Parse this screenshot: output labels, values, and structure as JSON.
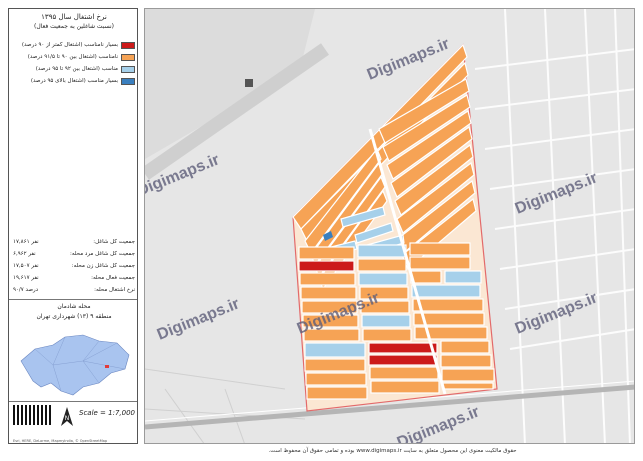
{
  "legend": {
    "title_line1": "نرخ اشتغال سال ۱۳۹۵",
    "title_line2": "(نسبت شاغلین به جمعیت فعال)",
    "items": [
      {
        "label": "بسیار نامناسب (اشتغال کمتر از ۹۰ درصد)",
        "color": "#cc1a1a"
      },
      {
        "label": "نامناسب (اشتغال بین ۹۰ تا ۹۱/۵ درصد)",
        "color": "#f6a355"
      },
      {
        "label": "مناسب (اشتغال بین ۹۲ تا ۹۵ درصد)",
        "color": "#a6d0ea"
      },
      {
        "label": "بسیار مناسب (اشتغال بالای ۹۵ درصد)",
        "color": "#3a7fbf"
      }
    ],
    "stats": [
      {
        "label": "جمعیت کل شاغل:",
        "value": "۱۷,۸۶۱ نفر"
      },
      {
        "label": "جمعیت کل شاغل مرد محله:",
        "value": "۶,۹۶۲ نفر"
      },
      {
        "label": "جمعیت کل شاغل زن محله:",
        "value": "۱۷,۵۰۷ نفر"
      },
      {
        "label": "جمعیت فعال محله:",
        "value": "۱۹,۶۱۷ نفر"
      },
      {
        "label": "نرخ اشتغال محله:",
        "value": "۹۰/۷ درصد"
      }
    ],
    "district_line1": "محله شادمان",
    "district_line2": "منطقه ۹ (۱۳) شهرداری تهران",
    "scale": "Scale = 1:7,000",
    "provider": "Esri, HERE, DeLorme, MapmyIndia, © OpenStreetMap"
  },
  "watermark": "Digimaps.ir",
  "copyright": "حقوق مالکیت معنوی این محصول متعلق به سایت www.digimaps.ir بوده و تمامی حقوق آن محفوظ است."
}
